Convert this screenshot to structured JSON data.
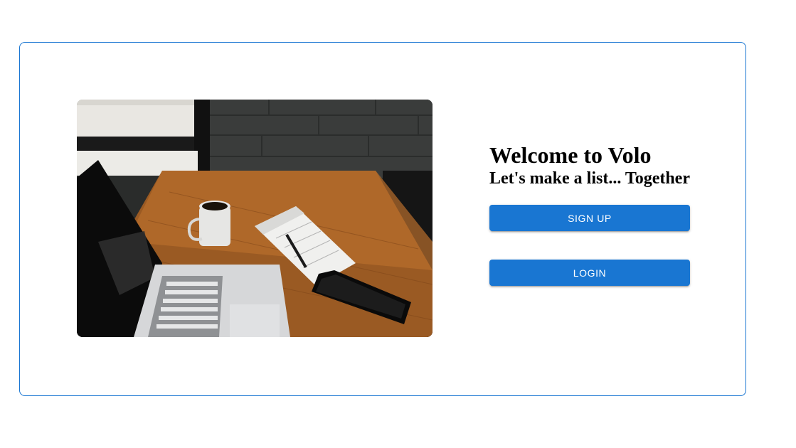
{
  "welcome": {
    "title": "Welcome to Volo",
    "subtitle": "Let's make a list... Together"
  },
  "actions": {
    "signup_label": "SIGN UP",
    "login_label": "LOGIN"
  },
  "hero_image": {
    "icon": "desk-workspace-photo"
  },
  "colors": {
    "accent": "#1976d2",
    "card_border": "#1976d2"
  }
}
